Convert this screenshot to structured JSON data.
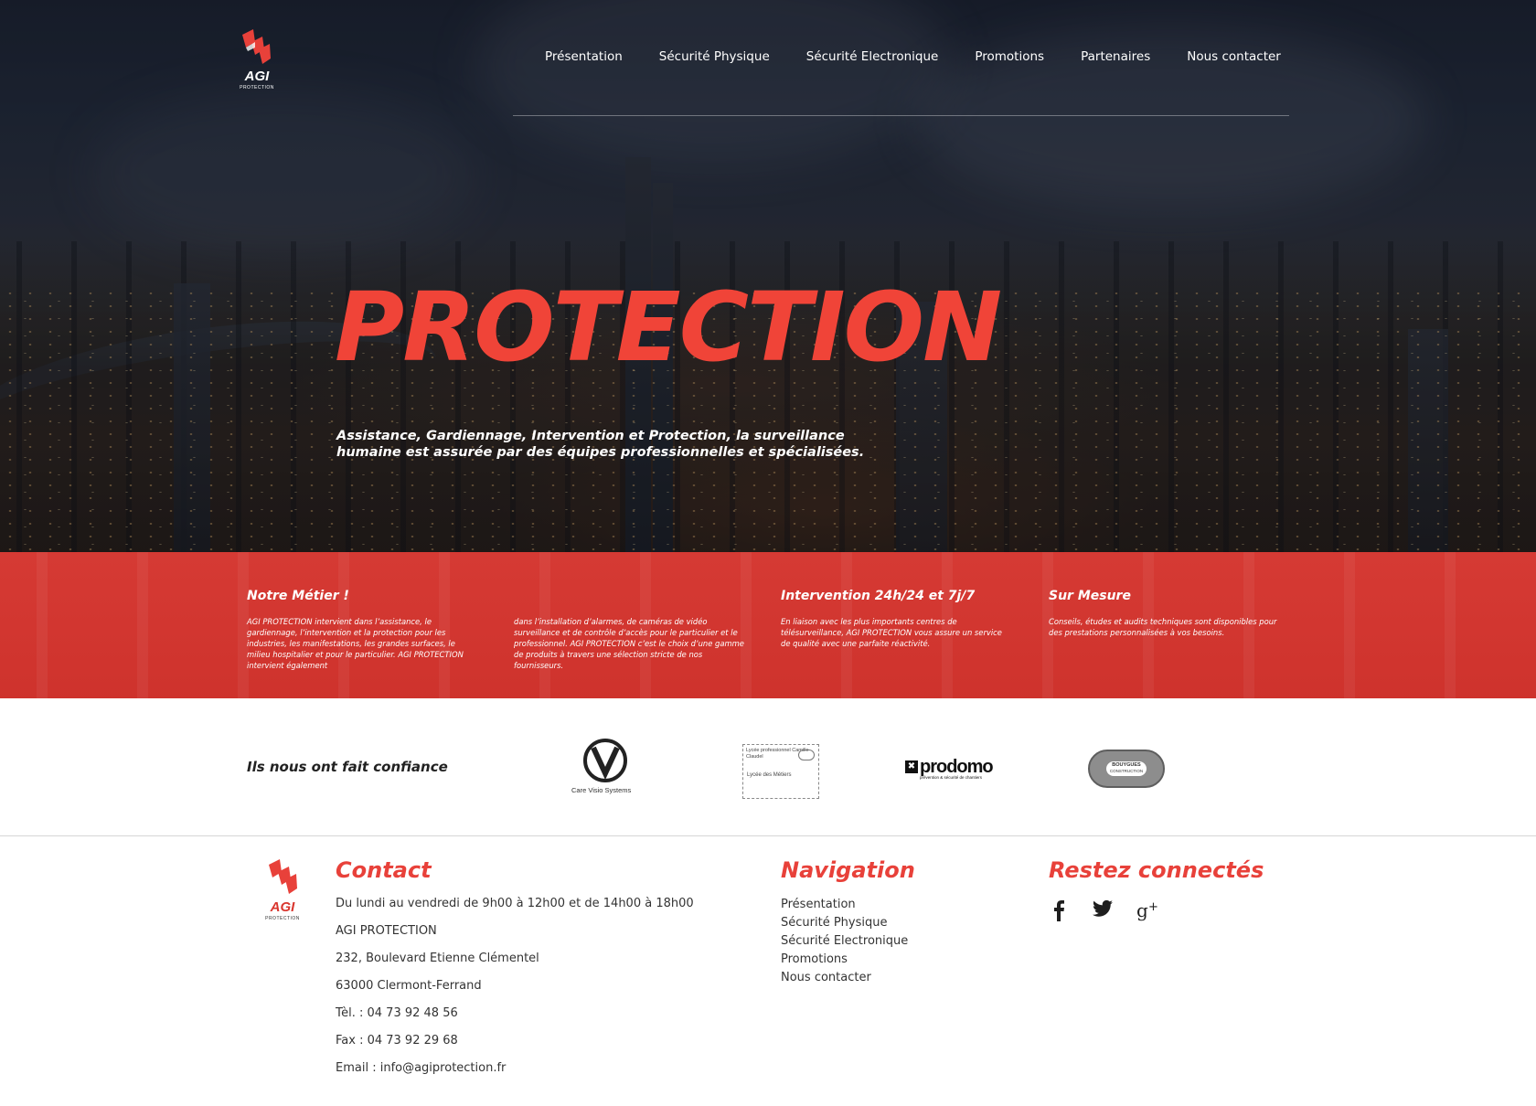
{
  "brand": {
    "name": "AGI",
    "tagline": "PROTECTION"
  },
  "nav": {
    "items": [
      {
        "label": "Présentation"
      },
      {
        "label": "Sécurité Physique"
      },
      {
        "label": "Sécurité Electronique"
      },
      {
        "label": "Promotions"
      },
      {
        "label": "Partenaires"
      },
      {
        "label": "Nous contacter"
      }
    ]
  },
  "hero": {
    "title": "PROTECTION",
    "subtitle": "Assistance, Gardiennage, Intervention et Protection, la surveillance humaine est assurée par des équipes professionnelles et spécialisées."
  },
  "features": {
    "metier_title": "Notre Métier !",
    "metier_text_1": "AGI PROTECTION intervient dans l’assistance, le gardiennage, l’intervention et la protection pour les industries, les manifestations, les grandes surfaces, le milieu hospitalier et pour le particulier. AGI PROTECTION intervient également",
    "metier_text_2": "dans l’installation d’alarmes, de caméras de vidéo surveillance et de contrôle d’accès pour le particulier et le professionnel. AGI PROTECTION c’est le choix d’une gamme de produits à travers une sélection stricte de nos fournisseurs.",
    "intervention_title": "Intervention 24h/24 et 7j/7",
    "intervention_text": "En liaison avec les plus importants centres de télésurveillance, AGI PROTECTION vous assure un service de qualité avec une parfaite réactivité.",
    "mesure_title": "Sur Mesure",
    "mesure_text": "Conseils, études et audits techniques sont disponibles pour des prestations personnalisées à vos besoins."
  },
  "clients": {
    "title": "Ils nous ont fait confiance",
    "logos": [
      {
        "name": "Care Visio Systems",
        "caption": "Care Visio Systems"
      },
      {
        "name": "Lycée des Métiers",
        "caption_top": "Lycée professionnel Camille Claudel",
        "caption_bottom": "Lycée des Métiers"
      },
      {
        "name": "prodomo",
        "caption": "prodomo",
        "subcaption": "prévention & sécurité de chantiers"
      },
      {
        "name": "Bouygues Construction",
        "caption": "BOUYGUES",
        "subcaption": "CONSTRUCTION"
      }
    ]
  },
  "footer": {
    "contact_title": "Contact",
    "contact_lines": {
      "hours": "Du lundi au vendredi de 9h00 à 12h00 et de 14h00 à 18h00",
      "company": "AGI PROTECTION",
      "street": "232, Boulevard Etienne Clémentel",
      "city": "63000 Clermont-Ferrand",
      "tel": "Tèl. : 04 73 92 48 56",
      "fax": "Fax : 04 73 92 29 68",
      "email": "Email : info@agiprotection.fr"
    },
    "nav_title": "Navigation",
    "nav_links": [
      {
        "label": "Présentation"
      },
      {
        "label": "Sécurité Physique"
      },
      {
        "label": "Sécurité Electronique"
      },
      {
        "label": "Promotions"
      },
      {
        "label": "Nous contacter"
      }
    ],
    "social_title": "Restez connectés",
    "social": [
      {
        "icon": "facebook-icon",
        "glyph": "f"
      },
      {
        "icon": "twitter-icon",
        "glyph": "🐦"
      },
      {
        "icon": "google-plus-icon",
        "glyph": "g+"
      }
    ]
  },
  "colors": {
    "accent": "#e8413a",
    "band": "#d23a33",
    "text": "#333333"
  }
}
